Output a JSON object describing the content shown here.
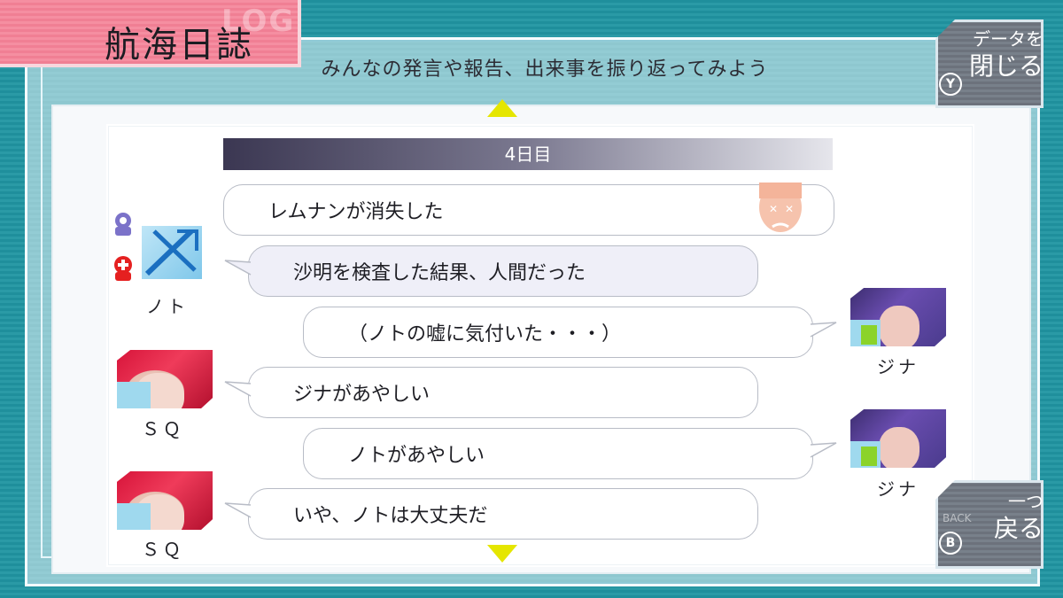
{
  "title": {
    "main": "航海日誌",
    "ghost": "LOG",
    "subtitle": "みんなの発言や報告、出来事を振り返ってみよう"
  },
  "buttons": {
    "close": {
      "line1": "データを",
      "line2": "閉じる",
      "key": "Y"
    },
    "back": {
      "line1": "一つ",
      "line2": "戻る",
      "key": "B",
      "ghost": "BACK"
    }
  },
  "day_header": "4日目",
  "characters": {
    "noto": "ノト",
    "sq": "ＳＱ",
    "jina": "ジナ"
  },
  "messages": [
    {
      "text": "レムナンが消失した",
      "speaker": ""
    },
    {
      "text": "沙明を検査した結果、人間だった",
      "speaker": "noto"
    },
    {
      "text": "（ノトの嘘に気付いた・・・）",
      "speaker": "jina"
    },
    {
      "text": "ジナがあやしい",
      "speaker": "sq"
    },
    {
      "text": "ノトがあやしい",
      "speaker": "jina"
    },
    {
      "text": "いや、ノトは大丈夫だ",
      "speaker": "sq"
    }
  ],
  "colors": {
    "accent_yellow": "#e5e600",
    "title_pink": "#f07f94",
    "teal_bg": "#1f8f9c"
  }
}
